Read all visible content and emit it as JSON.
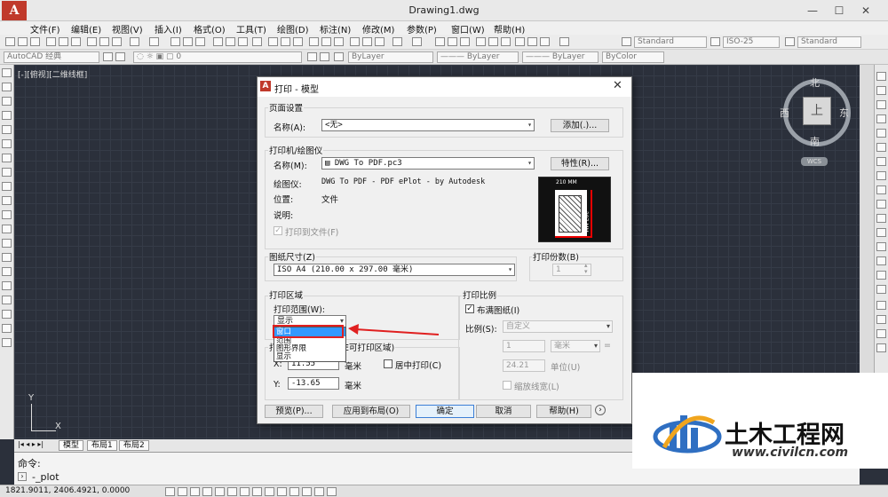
{
  "window": {
    "title": "Drawing1.dwg",
    "logo_letter": "A",
    "minimize": "—",
    "maximize": "☐",
    "close": "✕"
  },
  "menu": [
    "文件(F)",
    "编辑(E)",
    "视图(V)",
    "插入(I)",
    "格式(O)",
    "工具(T)",
    "绘图(D)",
    "标注(N)",
    "修改(M)",
    "参数(P)",
    "窗口(W)",
    "帮助(H)"
  ],
  "toolbar": {
    "text_style": "Standard",
    "dim_style": "ISO-25",
    "table_style": "Standard",
    "workspace": "AutoCAD 经典",
    "layer": "0",
    "color": "ByLayer",
    "linetype": "ByLayer",
    "lineweight": "ByLayer",
    "plotstyle": "ByColor"
  },
  "viewport_label": "[-][俯视][二维线框]",
  "viewcube": {
    "north": "北",
    "south": "南",
    "east": "东",
    "west": "西",
    "face": "上",
    "wcs": "WCS"
  },
  "ucs": {
    "y": "Y",
    "x": "X"
  },
  "layout_tabs": [
    "模型",
    "布局1",
    "布局2"
  ],
  "command": {
    "prompt": "命令:",
    "input": "-_plot"
  },
  "status": {
    "coords": "1821.9011, 2406.4921, 0.0000"
  },
  "dialog": {
    "title": "打印 - 模型",
    "page_setup": {
      "section": "页面设置",
      "name_label": "名称(A):",
      "name_value": "<无>",
      "add_button": "添加(.)..."
    },
    "printer": {
      "section": "打印机/绘图仪",
      "name_label": "名称(M):",
      "name_value": "DWG To PDF.pc3",
      "properties_button": "特性(R)...",
      "plotter_label": "绘图仪:",
      "plotter_value": "DWG To PDF - PDF ePlot - by Autodesk",
      "location_label": "位置:",
      "location_value": "文件",
      "description_label": "说明:",
      "plot_to_file": "打印到文件(F)",
      "preview_width": "210 MM",
      "preview_height": "297 MM"
    },
    "paper_size": {
      "section": "图纸尺寸(Z)",
      "value": "ISO A4 (210.00 x 297.00 毫米)"
    },
    "copies": {
      "section": "打印份数(B)",
      "value": "1"
    },
    "plot_area": {
      "section": "打印区域",
      "range_label": "打印范围(W):",
      "selected": "显示",
      "options": [
        "窗口",
        "范围",
        "图形界限",
        "显示"
      ],
      "highlighted": "窗口"
    },
    "plot_offset": {
      "section_fragment": "打",
      "section_tail": "E可打印区域)",
      "x_label": "X:",
      "x_value": "11.55",
      "y_label": "Y:",
      "y_value": "-13.65",
      "unit": "毫米",
      "center_plot": "居中打印(C)"
    },
    "plot_scale": {
      "section": "打印比例",
      "fit": "布满图纸(I)",
      "scale_label": "比例(S):",
      "scale_value": "自定义",
      "value1": "1",
      "unit1": "毫米",
      "equals": "=",
      "value2": "24.21",
      "unit2": "单位(U)",
      "scale_lineweights": "缩放线宽(L)"
    },
    "buttons": {
      "preview": "预览(P)...",
      "apply": "应用到布局(O)",
      "ok": "确定",
      "cancel": "取消",
      "help": "帮助(H)",
      "more": "›"
    }
  },
  "watermark": {
    "title": "土木工程网",
    "url": "www.civilcn.com"
  }
}
